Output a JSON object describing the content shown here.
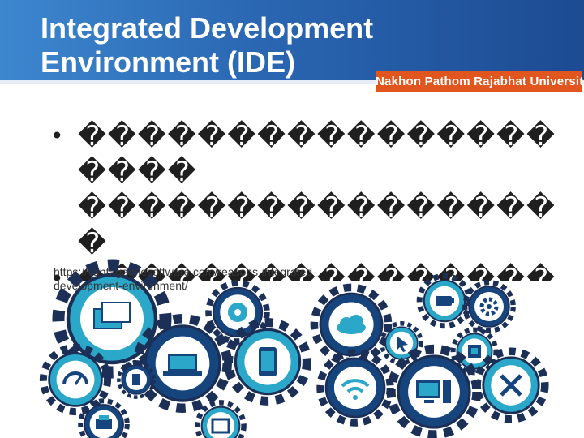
{
  "slide": {
    "title": "Integrated Development\nEnvironment (IDE)",
    "university": "Nakhon Pathom Rajabhat University",
    "bullets": [
      "��������������������\n�����������������",
      "��������������������\n������",
      "��������������������"
    ],
    "source_url": "https://vantageonesoftware.com/reasons-integrated-\ndevelopment-environment/"
  },
  "colors": {
    "header_dark": "#1c4b92",
    "header_light": "#3d87cf",
    "badge": "#e0561e",
    "gear_cyan": "#2aa7c9",
    "gear_dark": "#16457e",
    "gear_outline": "#1b2f57"
  },
  "icons": [
    "windows-icon",
    "disc-icon",
    "cloud-icon",
    "battery-icon",
    "gear-icon",
    "speedometer-icon",
    "sd-card-icon",
    "laptop-icon",
    "phone-icon",
    "wifi-icon",
    "cursor-icon",
    "chip-icon",
    "monitor-tower-icon",
    "tools-icon",
    "printer-icon",
    "photo-icon"
  ]
}
